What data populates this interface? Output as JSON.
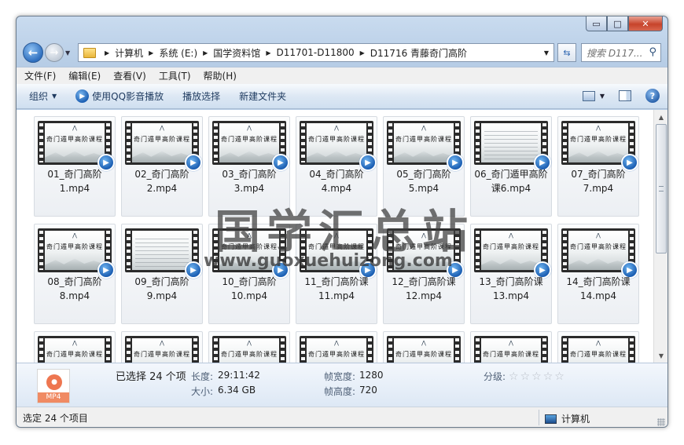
{
  "window": {
    "minimize": "▭",
    "maximize": "□",
    "close": "✕"
  },
  "address": {
    "crumbs": [
      "计算机",
      "系统 (E:)",
      "国学资料馆",
      "D11701-D11800",
      "D11716 青藤奇门高阶"
    ],
    "search_placeholder": "搜索 D117..."
  },
  "menubar": {
    "items": [
      "文件(F)",
      "编辑(E)",
      "查看(V)",
      "工具(T)",
      "帮助(H)"
    ]
  },
  "toolbar": {
    "organize": "组织",
    "play_qq": "使用QQ影音播放",
    "play_selected": "播放选择",
    "new_folder": "新建文件夹"
  },
  "files": {
    "row1": [
      {
        "line1": "01_奇门高阶",
        "line2": "1.mp4"
      },
      {
        "line1": "02_奇门高阶",
        "line2": "2.mp4"
      },
      {
        "line1": "03_奇门高阶",
        "line2": "3.mp4"
      },
      {
        "line1": "04_奇门高阶",
        "line2": "4.mp4"
      },
      {
        "line1": "05_奇门高阶",
        "line2": "5.mp4"
      },
      {
        "line1": "06_奇门遁甲高阶",
        "line2": "课6.mp4"
      },
      {
        "line1": "07_奇门高阶",
        "line2": "7.mp4"
      }
    ],
    "row2": [
      {
        "line1": "08_奇门高阶",
        "line2": "8.mp4"
      },
      {
        "line1": "09_奇门高阶",
        "line2": "9.mp4"
      },
      {
        "line1": "10_奇门高阶",
        "line2": "10.mp4"
      },
      {
        "line1": "11_奇门高阶课",
        "line2": "11.mp4"
      },
      {
        "line1": "12_奇门高阶课",
        "line2": "12.mp4"
      },
      {
        "line1": "13_奇门高阶课",
        "line2": "13.mp4"
      },
      {
        "line1": "14_奇门高阶课",
        "line2": "14.mp4"
      }
    ],
    "slide_title": "奇门遁甲高阶课程"
  },
  "watermark": {
    "chinese": "国学汇总站",
    "url": "www.guoxuehuizong.com"
  },
  "details": {
    "icon_label": "MP4",
    "selected": "已选择 24 个项",
    "length_key": "长度:",
    "length_value": "29:11:42",
    "size_key": "大小:",
    "size_value": "6.34 GB",
    "width_key": "帧宽度:",
    "width_value": "1280",
    "height_key": "帧高度:",
    "height_value": "720",
    "rating_key": "分级:"
  },
  "status": {
    "left": "选定 24 个项目",
    "right": "计算机"
  }
}
